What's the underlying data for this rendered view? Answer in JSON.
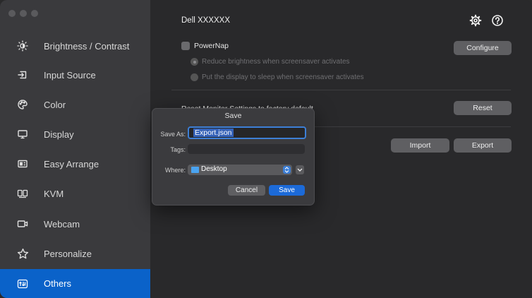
{
  "sidebar": {
    "items": [
      {
        "label": "Brightness / Contrast",
        "icon": "brightness-icon"
      },
      {
        "label": "Input Source",
        "icon": "input-source-icon"
      },
      {
        "label": "Color",
        "icon": "color-palette-icon"
      },
      {
        "label": "Display",
        "icon": "display-monitor-icon"
      },
      {
        "label": "Easy Arrange",
        "icon": "easy-arrange-icon"
      },
      {
        "label": "KVM",
        "icon": "kvm-icon"
      },
      {
        "label": "Webcam",
        "icon": "webcam-icon"
      },
      {
        "label": "Personalize",
        "icon": "star-icon"
      },
      {
        "label": "Others",
        "icon": "others-icon"
      }
    ],
    "active_index": 8,
    "accent": "#0a62c9"
  },
  "header": {
    "title": "Dell XXXXXX",
    "settings_icon": "gear-icon",
    "help_icon": "help-icon"
  },
  "powernap": {
    "label": "PowerNap",
    "checked": false,
    "option1": "Reduce brightness when screensaver activates",
    "option2": "Put the display to sleep when screensaver activates",
    "configure_label": "Configure"
  },
  "reset": {
    "label": "Reset Monitor Settings to factory default",
    "button": "Reset"
  },
  "import_export": {
    "import_label": "Import",
    "export_label": "Export"
  },
  "dialog": {
    "title": "Save",
    "save_as_label": "Save As:",
    "save_as_value": "Export.json",
    "tags_label": "Tags:",
    "tags_value": "",
    "where_label": "Where:",
    "where_value": "Desktop",
    "cancel_label": "Cancel",
    "save_label": "Save"
  }
}
